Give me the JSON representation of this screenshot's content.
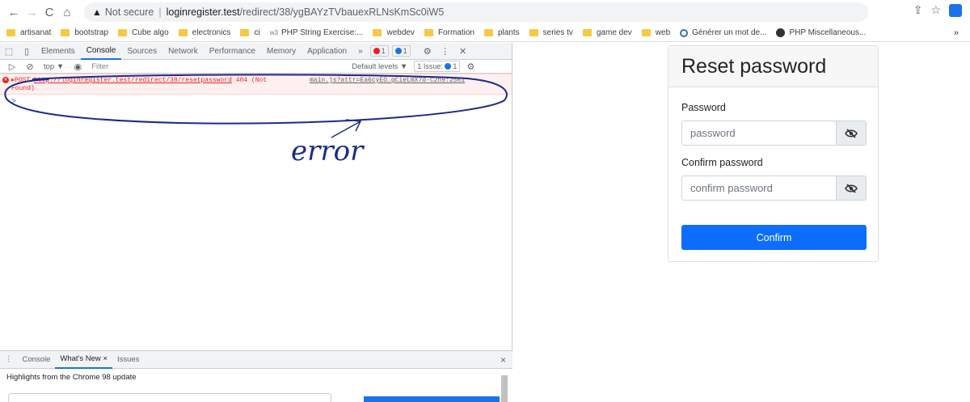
{
  "browser": {
    "url_warning": "Not secure",
    "url_host": "loginregister.test",
    "url_path": "/redirect/38/ygBAYzTVbauexRLNsKmSc0iW5"
  },
  "bookmarks": [
    "artisanat",
    "bootstrap",
    "Cube algo",
    "electronics",
    "ci",
    "PHP String Exercise:...",
    "webdev",
    "Formation",
    "plants",
    "series tv",
    "game dev",
    "web",
    "Générer un mot de...",
    "PHP Miscellaneous..."
  ],
  "bookmarks_more": "»",
  "devtools": {
    "tabs": [
      "Elements",
      "Console",
      "Sources",
      "Network",
      "Performance",
      "Memory",
      "Application"
    ],
    "active_tab": "Console",
    "more": "»",
    "error_count": "1",
    "msg_count": "1",
    "context": "top ▼",
    "filter_placeholder": "Filter",
    "levels": "Default levels ▼",
    "issues": "1 Issue:",
    "issues_count": "1",
    "error": {
      "method": "▸POST",
      "url": "http://loginregister.test/redirect/38/resetpassword",
      "status": "404 (Not",
      "status2": "Found)",
      "source": "main.js?attr=Ea6cyEO…gCieLmX7d-C2n9:2561"
    },
    "prompt": ">",
    "drawer_tabs": [
      "Console",
      "What's New ×",
      "Issues"
    ],
    "drawer_active": "What's New ×",
    "drawer_close": "×",
    "highlights": "Highlights from the Chrome 98 update"
  },
  "annotation_text": "error",
  "form": {
    "title": "Reset password",
    "password_label": "Password",
    "password_placeholder": "password",
    "confirm_label": "Confirm password",
    "confirm_placeholder": "confirm password",
    "button": "Confirm"
  }
}
